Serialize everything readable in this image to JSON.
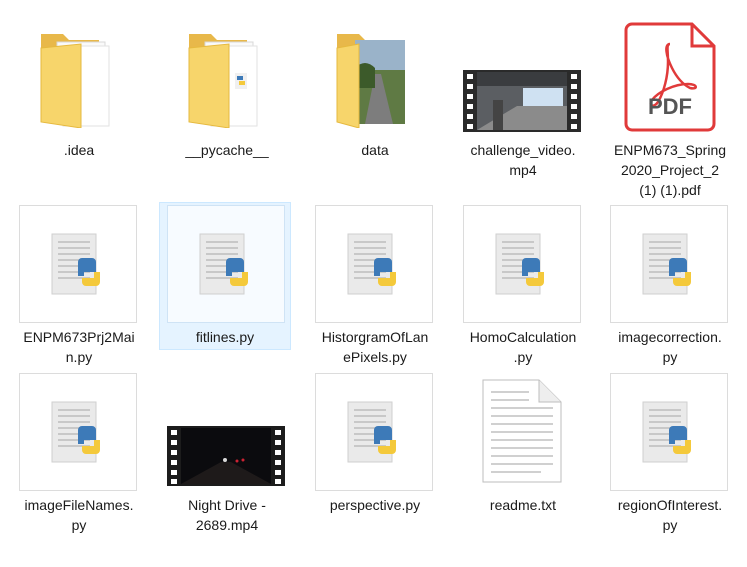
{
  "colors": {
    "selection_bg": "#e5f3ff",
    "folder_yellow": "#f7d56b",
    "pdf_red": "#e03a3a",
    "python_blue": "#3d7ab8",
    "python_yellow": "#f4c93b"
  },
  "items": [
    {
      "name": ".idea",
      "type": "folder",
      "icon": "folder-icon"
    },
    {
      "name": "__pycache__",
      "type": "folder",
      "icon": "folder-icon"
    },
    {
      "name": "data",
      "type": "folder",
      "icon": "folder-photo-icon"
    },
    {
      "name": "challenge_video.\nmp4",
      "type": "video",
      "icon": "video-thumbnail-icon"
    },
    {
      "name": "ENPM673_Spring\n2020_Project_2\n(1) (1).pdf",
      "type": "pdf",
      "icon": "pdf-icon",
      "icon_text": "PDF"
    },
    {
      "name": "ENPM673Prj2Mai\nn.py",
      "type": "python",
      "icon": "python-file-icon"
    },
    {
      "name": "fitlines.py",
      "type": "python",
      "icon": "python-file-icon",
      "selected": true
    },
    {
      "name": "HistorgramOfLan\nePixels.py",
      "type": "python",
      "icon": "python-file-icon"
    },
    {
      "name": "HomoCalculation\n.py",
      "type": "python",
      "icon": "python-file-icon"
    },
    {
      "name": "imagecorrection.\npy",
      "type": "python",
      "icon": "python-file-icon"
    },
    {
      "name": "imageFileNames.\npy",
      "type": "python",
      "icon": "python-file-icon"
    },
    {
      "name": "Night Drive -\n2689.mp4",
      "type": "video",
      "icon": "video-thumbnail-icon"
    },
    {
      "name": "perspective.py",
      "type": "python",
      "icon": "python-file-icon"
    },
    {
      "name": "readme.txt",
      "type": "text",
      "icon": "text-file-icon"
    },
    {
      "name": "regionOfInterest.\npy",
      "type": "python",
      "icon": "python-file-icon"
    }
  ]
}
